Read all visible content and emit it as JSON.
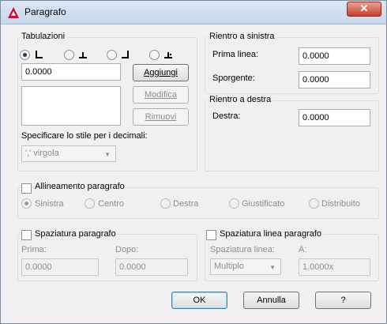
{
  "window": {
    "title": "Paragrafo",
    "close": "✕"
  },
  "tabs_group": {
    "title": "Tabulazioni",
    "tab_types": [
      "left-tab-icon",
      "center-tab-icon",
      "right-tab-icon",
      "decimal-tab-icon"
    ],
    "selected_tab": 0,
    "position_value": "0.0000",
    "add_button": "Aggiungi",
    "modify_button": "Modifica",
    "remove_button": "Rimuovi",
    "decimal_label": "Specificare lo stile per i decimali:",
    "decimal_value": "',' virgola"
  },
  "left_indent": {
    "title": "Rientro a sinistra",
    "first_line_label": "Prima linea:",
    "first_line_value": "0.0000",
    "hanging_label": "Sporgente:",
    "hanging_value": "0.0000"
  },
  "right_indent": {
    "title": "Rientro a destra",
    "right_label": "Destra:",
    "right_value": "0.0000"
  },
  "alignment": {
    "title": "Allineamento paragrafo",
    "checked": false,
    "options": [
      "Sinistra",
      "Centro",
      "Destra",
      "Giustificato",
      "Distribuito"
    ],
    "selected": 0
  },
  "spacing": {
    "title": "Spaziatura paragrafo",
    "before_label": "Prima:",
    "before_value": "0.0000",
    "after_label": "Dopo:",
    "after_value": "0.0000"
  },
  "line_spacing": {
    "title": "Spaziatura linea paragrafo",
    "type_label": "Spaziatura linea:",
    "type_value": "Multiplo",
    "at_label": "A:",
    "at_value": "1.0000x"
  },
  "buttons": {
    "ok": "OK",
    "cancel": "Annulla",
    "help": "?"
  }
}
